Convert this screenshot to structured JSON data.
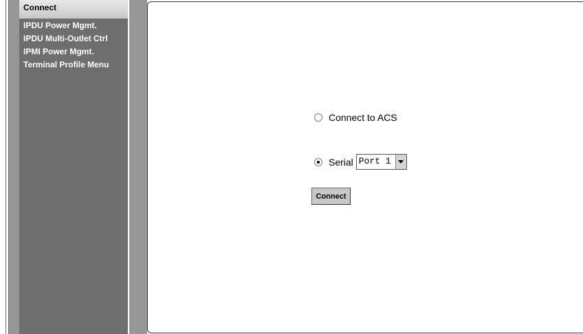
{
  "sidebar": {
    "items": [
      {
        "label": "Connect",
        "active": true
      },
      {
        "label": "IPDU Power Mgmt."
      },
      {
        "label": "IPDU Multi-Outlet Ctrl"
      },
      {
        "label": "IPMI Power Mgmt."
      },
      {
        "label": "Terminal Profile Menu"
      }
    ]
  },
  "main": {
    "options": {
      "acs_label": "Connect to ACS",
      "serial_label": "Serial",
      "selected": "serial"
    },
    "port_select": {
      "value": "Port 1"
    },
    "connect_button_label": "Connect"
  },
  "colors": {
    "sidebar_bg": "#6e6e6e",
    "strip_bg": "#969696",
    "active_item_bg": "#d8d8d8",
    "button_bg": "#c8c8c8"
  }
}
